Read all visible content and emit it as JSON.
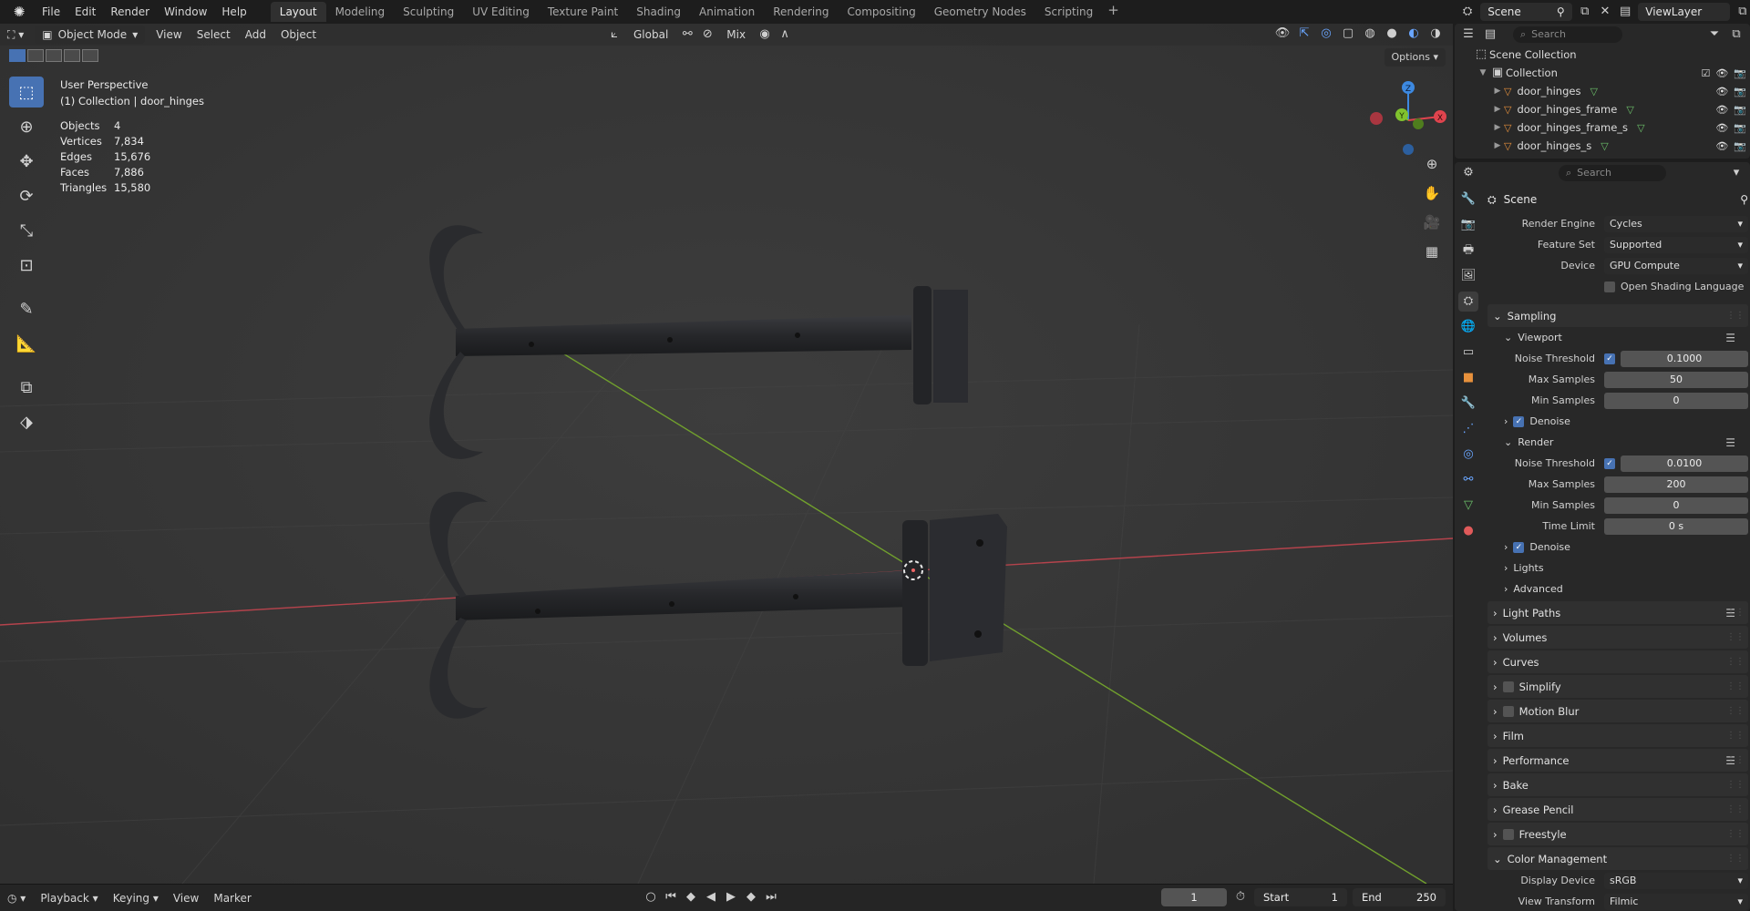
{
  "topbar": {
    "menus": [
      "File",
      "Edit",
      "Render",
      "Window",
      "Help"
    ],
    "workspaces": [
      "Layout",
      "Modeling",
      "Sculpting",
      "UV Editing",
      "Texture Paint",
      "Shading",
      "Animation",
      "Rendering",
      "Compositing",
      "Geometry Nodes",
      "Scripting"
    ],
    "active_workspace": "Layout"
  },
  "scene_selector": {
    "scene": "Scene",
    "view_layer": "ViewLayer"
  },
  "viewport": {
    "mode": "Object Mode",
    "menus": [
      "View",
      "Select",
      "Add",
      "Object"
    ],
    "orientation": "Global",
    "pivot_blend": "Mix",
    "options": "Options",
    "perspective": "User Perspective",
    "context": "(1) Collection | door_hinges",
    "stats": [
      {
        "label": "Objects",
        "value": "4"
      },
      {
        "label": "Vertices",
        "value": "7,834"
      },
      {
        "label": "Edges",
        "value": "15,676"
      },
      {
        "label": "Faces",
        "value": "7,886"
      },
      {
        "label": "Triangles",
        "value": "15,580"
      }
    ],
    "gizmo_axes": {
      "x": "X",
      "y": "Y",
      "z": "Z"
    }
  },
  "timeline": {
    "menus": [
      "Playback",
      "Keying",
      "View",
      "Marker"
    ],
    "current_frame": "1",
    "start_label": "Start",
    "start": "1",
    "end_label": "End",
    "end": "250"
  },
  "outliner": {
    "search_placeholder": "Search",
    "root": "Scene Collection",
    "collection": "Collection",
    "objects": [
      "door_hinges",
      "door_hinges_frame",
      "door_hinges_frame_s",
      "door_hinges_s"
    ]
  },
  "properties": {
    "search_placeholder": "Search",
    "title": "Scene",
    "render_engine_label": "Render Engine",
    "render_engine": "Cycles",
    "feature_set_label": "Feature Set",
    "feature_set": "Supported",
    "device_label": "Device",
    "device": "GPU Compute",
    "osl": "Open Shading Language",
    "sampling": "Sampling",
    "viewport_label": "Viewport",
    "render_label": "Render",
    "noise_threshold_label": "Noise Threshold",
    "vp_noise": "0.1000",
    "max_samples_label": "Max Samples",
    "vp_max": "50",
    "min_samples_label": "Min Samples",
    "vp_min": "0",
    "denoise": "Denoise",
    "r_noise": "0.0100",
    "r_max": "200",
    "r_min": "0",
    "time_limit_label": "Time Limit",
    "time_limit": "0 s",
    "lights": "Lights",
    "advanced": "Advanced",
    "panels": [
      "Light Paths",
      "Volumes",
      "Curves",
      "Simplify",
      "Motion Blur",
      "Film",
      "Performance",
      "Bake",
      "Grease Pencil",
      "Freestyle",
      "Color Management"
    ],
    "display_device_label": "Display Device",
    "display_device": "sRGB",
    "view_transform_label": "View Transform",
    "view_transform": "Filmic"
  },
  "colors": {
    "accent": "#4772b3",
    "x_axis": "#e0444e",
    "y_axis": "#80c22e",
    "z_axis": "#3d89e0",
    "object_orange": "#e7913c"
  }
}
